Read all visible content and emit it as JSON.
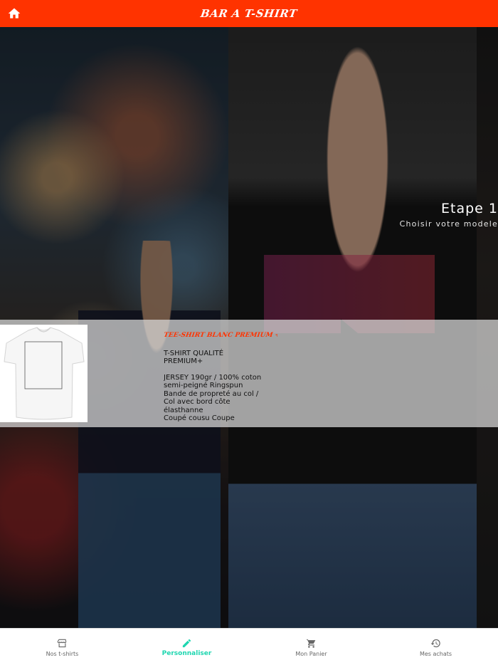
{
  "colors": {
    "accent": "#ff3300",
    "tab_active": "#1ed6b0",
    "tab_inactive": "#666666"
  },
  "header": {
    "title": "BAR A T-SHIRT",
    "home_icon": "home-icon"
  },
  "step": {
    "title": "Etape 1",
    "subtitle": "Choisir votre modele"
  },
  "product": {
    "name": "TEE-SHIRT BLANC PREMIUM +",
    "quality_lines": [
      "T-SHIRT QUALITÉ",
      "PREMIUM+"
    ],
    "description_lines": [
      "JERSEY 190gr / 100% coton",
      "semi-peigné Ringspun",
      "Bande de propreté au col /",
      "Col avec bord côte",
      "élasthanne",
      "Coupé cousu Coupe"
    ]
  },
  "tabs": [
    {
      "label": "Nos t-shirts",
      "icon": "storefront-icon",
      "active": false
    },
    {
      "label": "Personnaliser",
      "icon": "pencil-icon",
      "active": true
    },
    {
      "label": "Mon Panier",
      "icon": "cart-icon",
      "active": false
    },
    {
      "label": "Mes achats",
      "icon": "history-icon",
      "active": false
    }
  ]
}
